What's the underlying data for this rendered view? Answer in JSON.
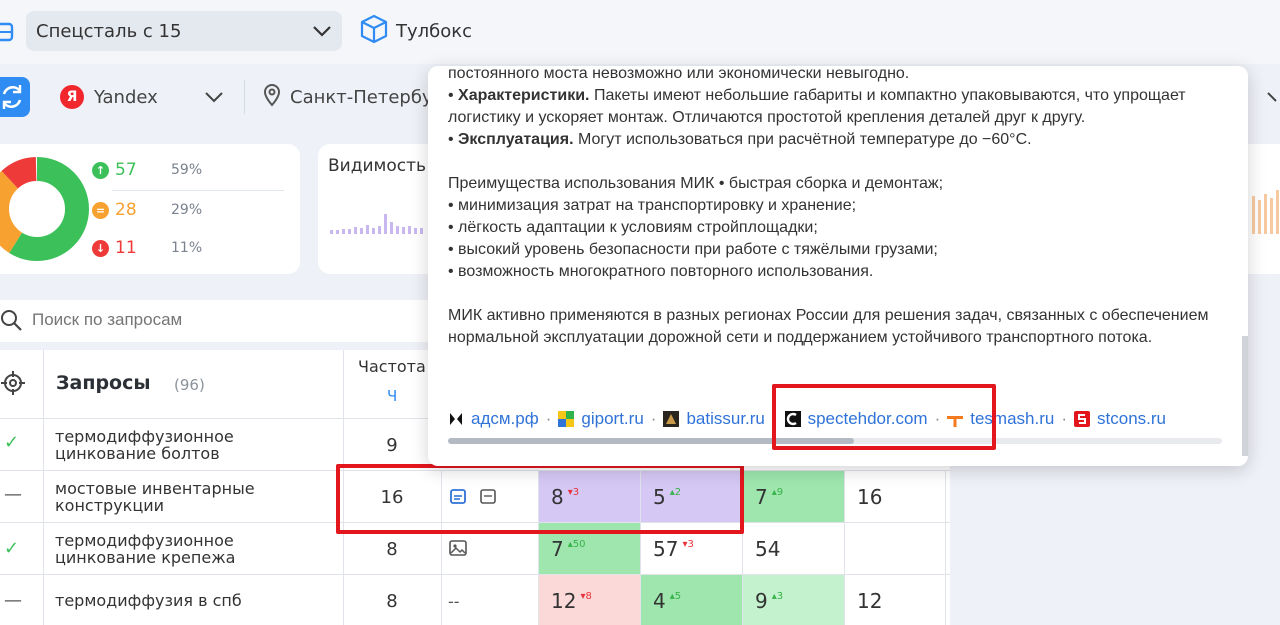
{
  "top": {
    "project": "Спецсталь с 15",
    "toolbox_label": "Тулбокс"
  },
  "filters": {
    "engine": "Yandex",
    "region": "Санкт-Петербург"
  },
  "stats": {
    "up": {
      "count": "57",
      "pct": "59%"
    },
    "same": {
      "count": "28",
      "pct": "29%"
    },
    "down": {
      "count": "11",
      "pct": "11%"
    },
    "colors": {
      "up": "#3cc15a",
      "same": "#f7a130",
      "down": "#ef3a3a"
    }
  },
  "visibility_label": "Видимость",
  "search": {
    "placeholder": "Поиск по запросам"
  },
  "table": {
    "header": {
      "queries": "Запросы",
      "count": "(96)",
      "frequency": "Частота",
      "frequency_sub": "Ч"
    },
    "rows": [
      {
        "status": "✓",
        "query": "термодиффузионное цинкование болтов",
        "freq": "9",
        "cells": []
      },
      {
        "status": "—",
        "query": "мостовые инвентарные конструкции",
        "freq": "16",
        "cells": [
          {
            "v": "8",
            "d": "▾3",
            "dir": "down"
          },
          {
            "v": "5",
            "d": "▴2",
            "dir": "up"
          },
          {
            "v": "7",
            "d": "▴9",
            "dir": "up"
          },
          {
            "v": "16",
            "d": "",
            "dir": ""
          }
        ]
      },
      {
        "status": "✓",
        "query": "термодиффузионное цинкование крепежа",
        "freq": "8",
        "cells": [
          {
            "v": "7",
            "d": "▴50",
            "dir": "up"
          },
          {
            "v": "57",
            "d": "▾3",
            "dir": "down"
          },
          {
            "v": "54",
            "d": "",
            "dir": ""
          },
          {
            "v": "",
            "d": "",
            "dir": ""
          }
        ]
      },
      {
        "status": "—",
        "query": "термодиффузия в спб",
        "freq": "8",
        "dash": "--",
        "cells": [
          {
            "v": "12",
            "d": "▾8",
            "dir": "down"
          },
          {
            "v": "4",
            "d": "▴5",
            "dir": "up"
          },
          {
            "v": "9",
            "d": "▴3",
            "dir": "up"
          },
          {
            "v": "12",
            "d": "",
            "dir": ""
          }
        ]
      }
    ]
  },
  "popup": {
    "line1": "постоянного моста невозможно или экономически невыгодно.",
    "char_title": "Характеристики.",
    "char_text": " Пакеты имеют небольшие габариты и компактно упаковываются, что упрощает логистику и ускоряет монтаж. Отличаются простотой крепления деталей друг к другу.",
    "exp_title": "Эксплуатация.",
    "exp_text": " Могут использоваться при расчётной температуре до −60°C.",
    "adv_header": "Преимущества использования МИК • быстрая сборка и демонтаж;",
    "adv_items": [
      "• минимизация затрат на транспортировку и хранение;",
      "• лёгкость адаптации к условиям стройплощадки;",
      "• высокий уровень безопасности при работе с тяжёлыми грузами;",
      "• возможность многократного повторного использования."
    ],
    "closing": "МИК активно применяются в разных регионах России для решения задач, связанных с обеспечением нормальной эксплуатации дорожной сети и поддержанием устойчивого транспортного потока.",
    "sources": [
      "адсм.рф",
      "giport.ru",
      "batissur.ru",
      "spectehdor.com",
      "tesmash.ru",
      "stcons.ru"
    ]
  }
}
